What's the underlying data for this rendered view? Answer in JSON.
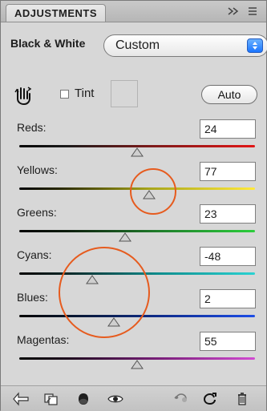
{
  "panel": {
    "tab_title": "ADJUSTMENTS",
    "header_icons": [
      "double-chevron-right-icon",
      "panel-menu-icon"
    ]
  },
  "preset": {
    "label": "Black & White",
    "value": "Custom"
  },
  "tint": {
    "label": "Tint",
    "checked": false
  },
  "auto_button": {
    "label": "Auto"
  },
  "sliders": [
    {
      "label": "Reds:",
      "value": "24",
      "level": 0.5
    },
    {
      "label": "Yellows:",
      "value": "77",
      "level": 0.55
    },
    {
      "label": "Greens:",
      "value": "23",
      "level": 0.45
    },
    {
      "label": "Cyans:",
      "value": "-48",
      "level": 0.31
    },
    {
      "label": "Blues:",
      "value": "2",
      "level": 0.4
    },
    {
      "label": "Magentas:",
      "value": "55",
      "level": 0.5
    }
  ],
  "toolbar": {
    "icons": [
      "back-arrow-icon",
      "clip-to-layer-icon",
      "layer-mask-icon",
      "eye-icon",
      "previous-state-icon",
      "reset-icon",
      "trash-icon"
    ]
  },
  "colors": {
    "highlight": "#e65b1e",
    "select_accent": "#1b75ff"
  }
}
